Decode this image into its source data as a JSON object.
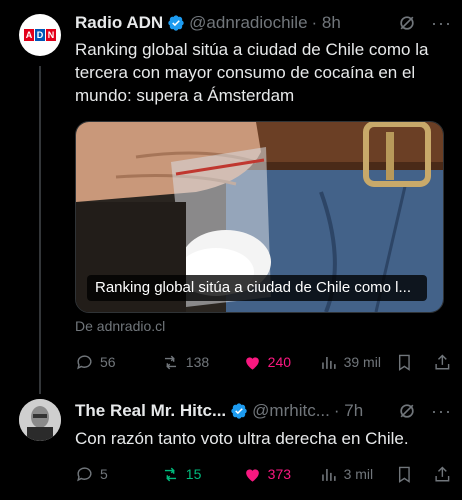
{
  "tweet1": {
    "name": "Radio ADN",
    "handle": "@adnradiochile",
    "time": "· 8h",
    "more": "···",
    "text": "Ranking global sitúa a ciudad de Chile como la tercera con mayor consumo de cocaína en el mundo: supera a Ámsterdam",
    "card_caption": "Ranking global sitúa a ciudad de Chile como l...",
    "source": "De adnradio.cl",
    "replies": "56",
    "reposts": "138",
    "likes": "240",
    "views": "39 mil"
  },
  "tweet2": {
    "name": "The Real Mr. Hitc...",
    "handle": "@mrhitc...",
    "time": "· 7h",
    "more": "···",
    "text": "Con razón tanto voto ultra derecha en Chile.",
    "replies": "5",
    "reposts": "15",
    "likes": "373",
    "views": "3 mil"
  },
  "colors": {
    "verified": "#1d9bf0",
    "like": "#f91880",
    "repost_active": "#00ba7c",
    "muted": "#71767b"
  },
  "logo_letters": [
    "A",
    "D",
    "N"
  ]
}
